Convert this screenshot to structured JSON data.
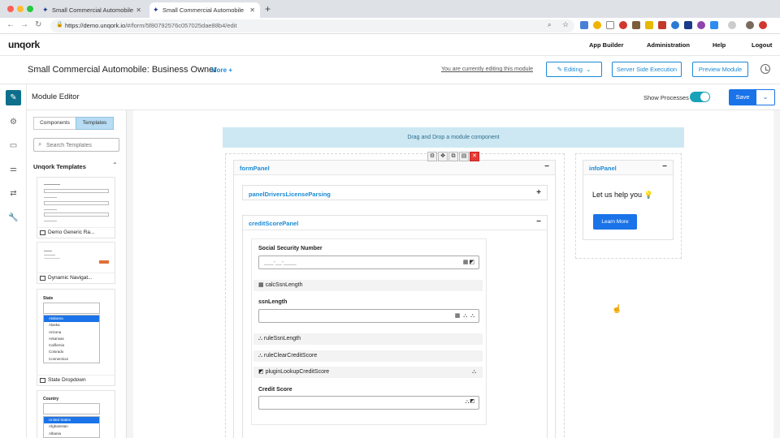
{
  "browser": {
    "tabs": [
      {
        "title": "Small Commercial Automobile",
        "active": false
      },
      {
        "title": "Small Commercial Automobile",
        "active": true
      }
    ],
    "url_host": "https://demo.unqork.io",
    "url_path": "/#/form/5f80792576c057025dae88b4/edit"
  },
  "app": {
    "logo": "unqork",
    "nav": [
      "App Builder",
      "Administration",
      "Help",
      "Logout"
    ]
  },
  "module": {
    "title": "Small Commercial Automobile: Business Owner",
    "more": "More +",
    "editing_note": "You are currently editing this module",
    "editing_button": "Editing",
    "sse_button": "Server Side Execution",
    "preview_button": "Preview Module"
  },
  "editor": {
    "title": "Module Editor",
    "show_processes": "Show Processes",
    "save": "Save"
  },
  "left_panel": {
    "tab_components": "Components",
    "tab_templates": "Templates",
    "search_placeholder": "Search Templates",
    "section_title": "Unqork Templates",
    "templates": [
      {
        "label": "Demo Generic Ra..."
      },
      {
        "label": "Dynamic Navigat..."
      },
      {
        "label": "State Dropdown"
      },
      {
        "label": ""
      }
    ],
    "state_thumb": {
      "label": "State",
      "options": [
        "Alabama",
        "Alaska",
        "Arizona",
        "Arkansas",
        "California",
        "Colorado",
        "Connecticut"
      ]
    },
    "country_thumb": {
      "label": "Country",
      "options": [
        "United States",
        "Afghanistan",
        "Albania"
      ]
    }
  },
  "canvas": {
    "dropzone": "Drag and Drop a module component",
    "form_panel": {
      "title": "formPanel",
      "collapse": "−",
      "children": {
        "drivers_panel": {
          "title": "panelDriversLicenseParsing",
          "expand": "+"
        },
        "credit_panel": {
          "title": "creditScorePanel",
          "collapse": "−",
          "ssn_label": "Social Security Number",
          "ssn_value": "___-__-____",
          "calc": "calcSsnLength",
          "ssn_length_label": "ssnLength",
          "rule_ssn": "ruleSsnLength",
          "rule_clear": "ruleClearCreditScore",
          "plugin": "pluginLookupCreditScore",
          "credit_label": "Credit Score"
        }
      }
    },
    "info_panel": {
      "title": "infoPanel",
      "collapse": "−",
      "help_text": "Let us help you 💡",
      "learn_more": "Learn More"
    }
  },
  "colors": {
    "accent": "#1a8ad4",
    "primary_button": "#1a73e8",
    "toggle": "#17a2b8",
    "active_rail": "#0e6f8c",
    "dropzone": "#cde8f3",
    "delete": "#e53935"
  }
}
